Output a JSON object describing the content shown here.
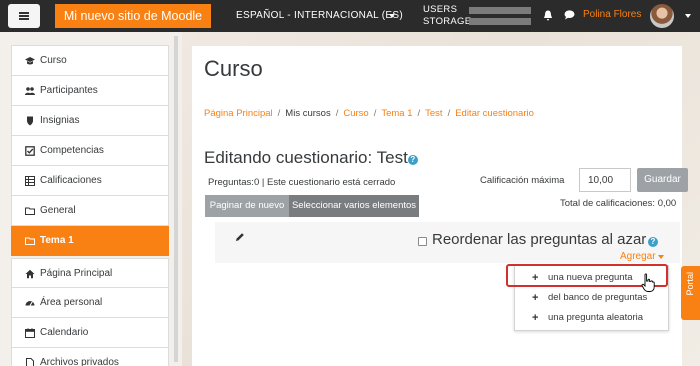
{
  "navbar": {
    "brand": "Mi nuevo sitio de Moodle",
    "language": "ESPAÑOL - INTERNACIONAL (ES)",
    "usage_users": "USERS",
    "usage_storage": "STORAGE",
    "username": "Polina Flores"
  },
  "sidebar": {
    "items": [
      {
        "label": "Curso",
        "icon": "graduation-cap-icon"
      },
      {
        "label": "Participantes",
        "icon": "users-icon"
      },
      {
        "label": "Insignias",
        "icon": "shield-icon"
      },
      {
        "label": "Competencias",
        "icon": "check-square-icon"
      },
      {
        "label": "Calificaciones",
        "icon": "table-icon"
      },
      {
        "label": "General",
        "icon": "folder-icon"
      },
      {
        "label": "Tema 1",
        "icon": "folder-icon"
      },
      {
        "label": "Página Principal",
        "icon": "home-icon"
      },
      {
        "label": "Área personal",
        "icon": "dashboard-icon"
      },
      {
        "label": "Calendario",
        "icon": "calendar-icon"
      },
      {
        "label": "Archivos privados",
        "icon": "file-icon"
      }
    ]
  },
  "header": {
    "title": "Curso",
    "breadcrumbs": [
      "Página Principal",
      "Mis cursos",
      "Curso",
      "Tema 1",
      "Test",
      "Editar cuestionario"
    ]
  },
  "quiz": {
    "title": "Editando cuestionario: Test",
    "info": "Preguntas:0 | Este cuestionario está cerrado",
    "max_grade_label": "Calificación máxima",
    "max_grade_value": "10,00",
    "save_label": "Guardar",
    "total_grades": "Total de calificaciones: 0,00",
    "repaginate_label": "Paginar de nuevo",
    "select_multiple_label": "Seleccionar varios elementos",
    "shuffle_label": "Reordenar las preguntas al azar",
    "add_label": "Agregar",
    "add_menu": [
      "una nueva pregunta",
      "del banco de preguntas",
      "una pregunta aleatoria"
    ]
  },
  "portal": {
    "label": "Portal"
  },
  "colors": {
    "accent": "#f98012",
    "navbar": "#2b2b2b",
    "highlight": "#d0312d"
  }
}
